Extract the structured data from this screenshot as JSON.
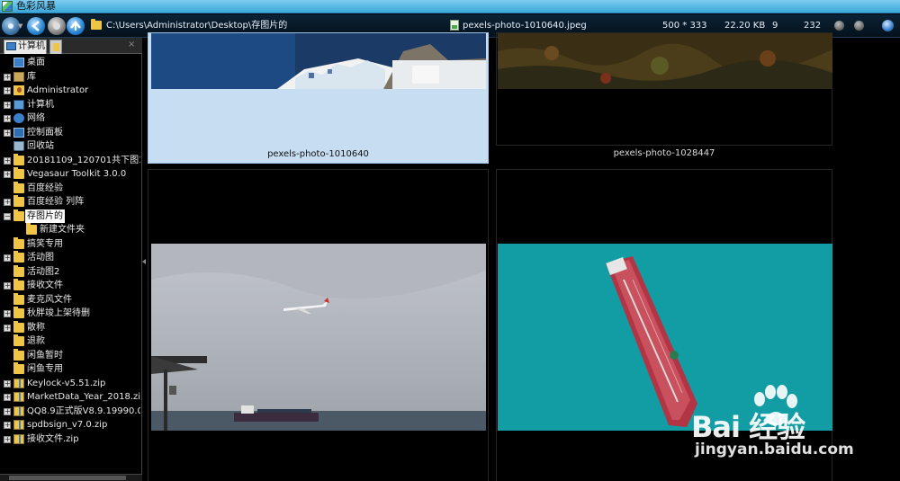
{
  "titlebar": {
    "title": "色彩风暴"
  },
  "toolbar": {
    "path": "C:\\Users\\Administrator\\Desktop\\存图片的",
    "filename": "pexels-photo-1010640.jpeg",
    "dimensions": "500 * 333",
    "filesize": "22.20 KB",
    "index": "9",
    "total": "232"
  },
  "left_panel": {
    "tab_label": "计算机",
    "close_glyph": "×",
    "tree": [
      {
        "label": "桌面",
        "icon": "desktop-icon",
        "expander": ""
      },
      {
        "label": "库",
        "icon": "library-icon",
        "expander": "+"
      },
      {
        "label": "Administrator",
        "icon": "user-folder-icon",
        "expander": "+"
      },
      {
        "label": "计算机",
        "icon": "computer-icon",
        "expander": "+"
      },
      {
        "label": "网络",
        "icon": "network-icon",
        "expander": "+"
      },
      {
        "label": "控制面板",
        "icon": "control-panel-icon",
        "expander": "+"
      },
      {
        "label": "回收站",
        "icon": "recycle-bin-icon",
        "expander": ""
      },
      {
        "label": "20181109_120701共下图1个",
        "icon": "folder-icon",
        "expander": "+"
      },
      {
        "label": "Vegasaur Toolkit 3.0.0",
        "icon": "folder-icon",
        "expander": "+"
      },
      {
        "label": "百度经验",
        "icon": "folder-icon",
        "expander": ""
      },
      {
        "label": "百度经验 列阵",
        "icon": "folder-icon",
        "expander": "+"
      },
      {
        "label": "存图片的",
        "icon": "folder-icon",
        "expander": "−",
        "selected": true
      },
      {
        "label": "新建文件夹",
        "icon": "folder-icon",
        "expander": "",
        "indent": 1
      },
      {
        "label": "搞笑专用",
        "icon": "folder-icon",
        "expander": ""
      },
      {
        "label": "活动图",
        "icon": "folder-icon",
        "expander": "+"
      },
      {
        "label": "活动图2",
        "icon": "folder-icon",
        "expander": ""
      },
      {
        "label": "接收文件",
        "icon": "folder-icon",
        "expander": "+"
      },
      {
        "label": "麦克风文件",
        "icon": "folder-icon",
        "expander": ""
      },
      {
        "label": "秋胖竣上架待删",
        "icon": "folder-icon",
        "expander": "+"
      },
      {
        "label": "散称",
        "icon": "folder-icon",
        "expander": "+"
      },
      {
        "label": "退款",
        "icon": "folder-icon",
        "expander": ""
      },
      {
        "label": "闲鱼暂时",
        "icon": "folder-icon",
        "expander": ""
      },
      {
        "label": "闲鱼专用",
        "icon": "folder-icon",
        "expander": ""
      },
      {
        "label": "Keylock-v5.51.zip",
        "icon": "zip-icon",
        "expander": "+"
      },
      {
        "label": "MarketData_Year_2018.zip",
        "icon": "zip-icon",
        "expander": "+"
      },
      {
        "label": "QQ8.9正式版V8.9.19990.0 P",
        "icon": "zip-icon",
        "expander": "+"
      },
      {
        "label": "spdbsign_v7.0.zip",
        "icon": "zip-icon",
        "expander": "+"
      },
      {
        "label": "接收文件.zip",
        "icon": "zip-icon",
        "expander": "+"
      }
    ]
  },
  "grid": {
    "items": [
      {
        "caption": "pexels-photo-1010640",
        "selected": true
      },
      {
        "caption": "pexels-photo-1028447",
        "selected": false
      },
      {
        "caption": "",
        "selected": false
      },
      {
        "caption": "",
        "selected": false
      }
    ]
  },
  "watermark": {
    "brand": "Bai 经验",
    "url": "jingyan.baidu.com"
  },
  "colors": {
    "accent": "#3aa7d9",
    "selection": "#c6ddf2",
    "toolbar": "#0b2236"
  }
}
